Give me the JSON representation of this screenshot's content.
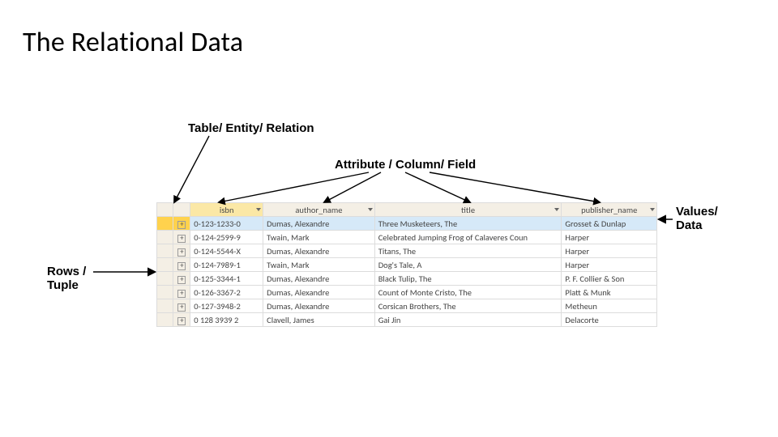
{
  "title": "The Relational Data",
  "labels": {
    "table": "Table/ Entity/ Relation",
    "attribute": "Attribute / Column/ Field",
    "values_l1": "Values/",
    "values_l2": "Data",
    "rows_l1": "Rows /",
    "rows_l2": "Tuple"
  },
  "columns": {
    "isbn": "isbn",
    "author": "author_name",
    "title": "title",
    "publisher": "publisher_name"
  },
  "rows": [
    {
      "isbn": "0-123-1233-0",
      "author": "Dumas, Alexandre",
      "title": "Three Musketeers, The",
      "publisher": "Grosset & Dunlap"
    },
    {
      "isbn": "0-124-2599-9",
      "author": "Twain, Mark",
      "title": "Celebrated Jumping Frog of Calaveres Coun",
      "publisher": "Harper"
    },
    {
      "isbn": "0-124-5544-X",
      "author": "Dumas, Alexandre",
      "title": "Titans, The",
      "publisher": "Harper"
    },
    {
      "isbn": "0-124-7989-1",
      "author": "Twain, Mark",
      "title": "Dog's Tale, A",
      "publisher": "Harper"
    },
    {
      "isbn": "0-125-3344-1",
      "author": "Dumas, Alexandre",
      "title": "Black Tulip, The",
      "publisher": "P. F. Collier & Son"
    },
    {
      "isbn": "0-126-3367-2",
      "author": "Dumas, Alexandre",
      "title": "Count of Monte Cristo, The",
      "publisher": "Platt & Munk"
    },
    {
      "isbn": "0-127-3948-2",
      "author": "Dumas, Alexandre",
      "title": "Corsican Brothers, The",
      "publisher": "Metheun"
    },
    {
      "isbn": "0 128 3939 2",
      "author": "Clavell, James",
      "title": "Gai Jin",
      "publisher": "Delacorte"
    }
  ]
}
